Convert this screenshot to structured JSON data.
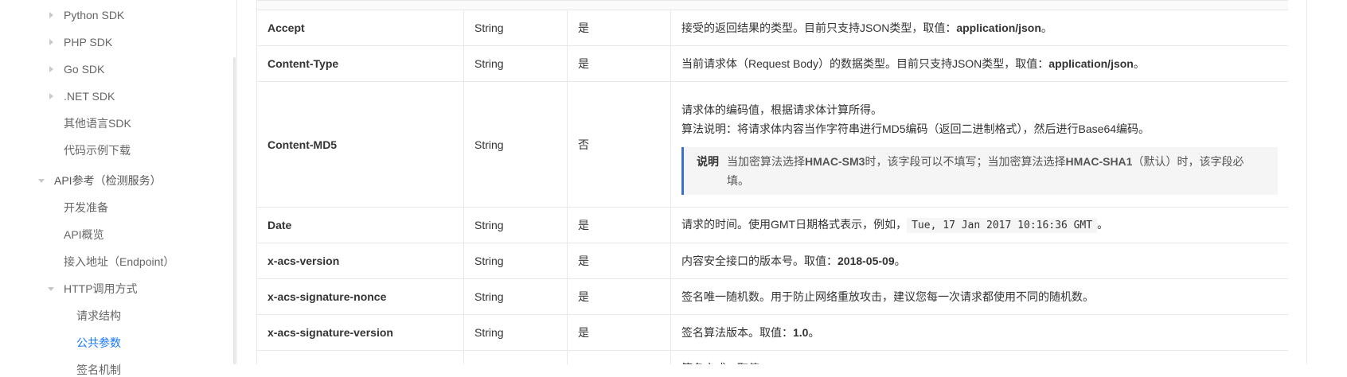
{
  "sidebar": {
    "items": [
      {
        "label": "Python SDK",
        "level": 2,
        "arrow": "right"
      },
      {
        "label": "PHP SDK",
        "level": 2,
        "arrow": "right"
      },
      {
        "label": "Go SDK",
        "level": 2,
        "arrow": "right"
      },
      {
        "label": ".NET SDK",
        "level": 2,
        "arrow": "right"
      },
      {
        "label": "其他语言SDK",
        "level": 2,
        "arrow": ""
      },
      {
        "label": "代码示例下载",
        "level": 2,
        "arrow": ""
      },
      {
        "label": "API参考（检测服务）",
        "level": 1,
        "arrow": "down"
      },
      {
        "label": "开发准备",
        "level": 2,
        "arrow": ""
      },
      {
        "label": "API概览",
        "level": 2,
        "arrow": ""
      },
      {
        "label": "接入地址（Endpoint）",
        "level": 2,
        "arrow": ""
      },
      {
        "label": "HTTP调用方式",
        "level": 2,
        "arrow": "down"
      },
      {
        "label": "请求结构",
        "level": 3,
        "arrow": ""
      },
      {
        "label": "公共参数",
        "level": 3,
        "arrow": "",
        "active": true
      },
      {
        "label": "签名机制",
        "level": 3,
        "arrow": ""
      }
    ]
  },
  "table": {
    "rows": [
      {
        "name": "Accept",
        "type": "String",
        "required": "是",
        "desc": [
          {
            "t": "接受的返回结果的类型。目前只支持JSON类型，取值："
          },
          {
            "b": "application/json"
          },
          {
            "t": "。"
          }
        ]
      },
      {
        "name": "Content-Type",
        "type": "String",
        "required": "是",
        "desc": [
          {
            "t": "当前请求体（Request Body）的数据类型。目前只支持JSON类型，取值："
          },
          {
            "b": "application/json"
          },
          {
            "t": "。"
          }
        ]
      },
      {
        "name": "Content-MD5",
        "type": "String",
        "required": "否",
        "desc_lines": [
          "请求体的编码值，根据请求体计算所得。",
          "算法说明：将请求体内容当作字符串进行MD5编码（返回二进制格式），然后进行Base64编码。"
        ],
        "note": {
          "label": "说明",
          "text": [
            {
              "t": "当加密算法选择"
            },
            {
              "b": "HMAC-SM3"
            },
            {
              "t": "时，该字段可以不填写；当加密算法选择"
            },
            {
              "b": "HMAC-SHA1"
            },
            {
              "t": "（默认）时，该字段必填。"
            }
          ]
        }
      },
      {
        "name": "Date",
        "type": "String",
        "required": "是",
        "desc": [
          {
            "t": "请求的时间。使用GMT日期格式表示，例如，"
          },
          {
            "c": "Tue, 17 Jan 2017 10:16:36 GMT"
          },
          {
            "t": "。"
          }
        ]
      },
      {
        "name": "x-acs-version",
        "type": "String",
        "required": "是",
        "desc": [
          {
            "t": "内容安全接口的版本号。取值："
          },
          {
            "b": "2018-05-09"
          },
          {
            "t": "。"
          }
        ]
      },
      {
        "name": "x-acs-signature-nonce",
        "type": "String",
        "required": "是",
        "desc": [
          {
            "t": "签名唯一随机数。用于防止网络重放攻击，建议您每一次请求都使用不同的随机数。"
          }
        ]
      },
      {
        "name": "x-acs-signature-version",
        "type": "String",
        "required": "是",
        "desc": [
          {
            "t": "签名算法版本。取值："
          },
          {
            "b": "1.0"
          },
          {
            "t": "。"
          }
        ]
      },
      {
        "name": "",
        "type": "",
        "required": "",
        "desc": [
          {
            "t": "签名方式。取值："
          }
        ]
      }
    ]
  }
}
